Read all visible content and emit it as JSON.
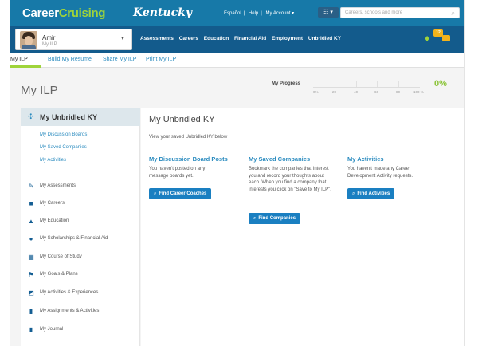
{
  "header": {
    "logo_part1": "Career",
    "logo_part2": "Cruising",
    "state_logo": "Kentucky",
    "links": [
      "Español",
      "Help",
      "My Account ▾"
    ],
    "grid_icon": "grid-icon",
    "search_placeholder": "Careers, schools and more"
  },
  "user": {
    "name": "Amir",
    "subtitle": "My ILP"
  },
  "main_nav": [
    "Assessments",
    "Careers",
    "Education",
    "Financial Aid",
    "Employment",
    "Unbridled KY"
  ],
  "notifications": {
    "count": "12"
  },
  "sub_nav": [
    "My ILP",
    "Build My Resume",
    "Share My ILP",
    "Print My ILP"
  ],
  "page": {
    "title": "My ILP",
    "progress_label": "My Progress",
    "progress_ticks": [
      "0%",
      "20",
      "40",
      "60",
      "80",
      "100 %"
    ],
    "progress_value": "0%"
  },
  "sidebar": {
    "title": "My Unbridled KY",
    "links": [
      "My Discussion Boards",
      "My Saved Companies",
      "My Activities"
    ],
    "items": [
      {
        "label": "My Assessments",
        "icon": "pencil-icon"
      },
      {
        "label": "My Careers",
        "icon": "briefcase-icon"
      },
      {
        "label": "My Education",
        "icon": "graduation-cap-icon"
      },
      {
        "label": "My Scholarships & Financial Aid",
        "icon": "piggy-bank-icon"
      },
      {
        "label": "My Course of Study",
        "icon": "table-icon"
      },
      {
        "label": "My Goals & Plans",
        "icon": "flag-icon"
      },
      {
        "label": "My Activities & Experiences",
        "icon": "external-link-icon"
      },
      {
        "label": "My Assignments & Activities",
        "icon": "clipboard-icon"
      },
      {
        "label": "My Journal",
        "icon": "book-icon"
      }
    ]
  },
  "content": {
    "title": "My Unbridled KY",
    "intro": "View your saved Unbridled KY below",
    "columns": [
      {
        "heading": "My Discussion Board Posts",
        "text": "You haven't posted on any message boards yet.",
        "button": "Find Career Coaches"
      },
      {
        "heading": "My Saved Companies",
        "text": "Bookmark the companies that interest you and record your thoughts about each. When you find a company that interests you click on \"Save to My ILP\".",
        "button": "Find Companies"
      },
      {
        "heading": "My Activities",
        "text": "You haven't made any Career Development Activity requests.",
        "button": "Find Activities"
      }
    ]
  }
}
